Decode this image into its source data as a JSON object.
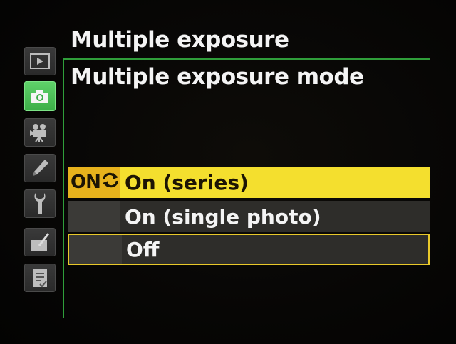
{
  "header": {
    "title": "Multiple exposure",
    "subtitle": "Multiple exposure mode"
  },
  "sidebar": {
    "items": [
      {
        "icon": "playback-icon",
        "active": false
      },
      {
        "icon": "camera-icon",
        "active": true
      },
      {
        "icon": "movie-icon",
        "active": false
      },
      {
        "icon": "pencil-icon",
        "active": false
      },
      {
        "icon": "wrench-icon",
        "active": false
      },
      {
        "icon": "retouch-icon",
        "active": false
      },
      {
        "icon": "my-menu-icon",
        "active": false
      }
    ]
  },
  "options": [
    {
      "label": "On (series)",
      "badge": "ON",
      "selected": true
    },
    {
      "label": "On (single photo)",
      "badge": "",
      "selected": false
    },
    {
      "label": "Off",
      "badge": "",
      "selected": false,
      "current": true
    }
  ],
  "colors": {
    "accent_green": "#2f9e3a",
    "highlight_yellow": "#f4df2e",
    "badge_amber": "#e7b21c",
    "text": "#f4f4f4"
  }
}
